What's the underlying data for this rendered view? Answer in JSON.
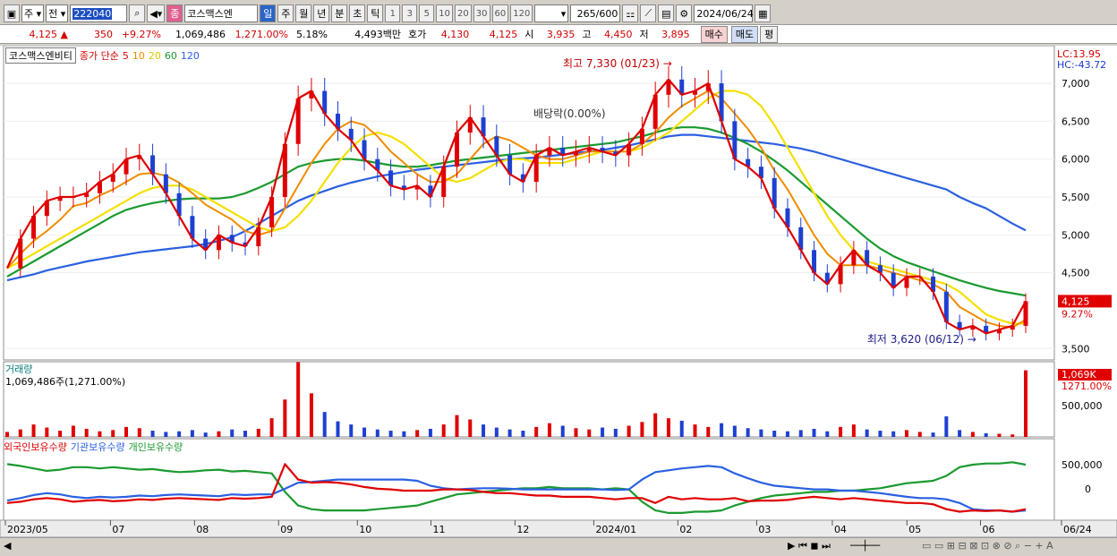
{
  "toolbar": {
    "period_type": "주",
    "prev_label": "전",
    "stock_code": "222040",
    "stock_name": "코스맥스엔",
    "tab_day": "일",
    "tab_week": "주",
    "tab_month": "월",
    "tab_year": "년",
    "tab_min": "분",
    "tab_sec": "초",
    "tab_tick": "틱",
    "intervals": [
      "1",
      "3",
      "5",
      "10",
      "20",
      "30",
      "60",
      "120"
    ],
    "count": "265",
    "count_total": "/600",
    "date": "2024/06/24",
    "badge": "종"
  },
  "quote": {
    "price": "4,125",
    "change": "350",
    "change_pct": "+9.27%",
    "volume": "1,069,486",
    "volume_ratio": "1,271.00%",
    "turnover": "5.18%",
    "amount": "4,493백만",
    "bid_label": "호가",
    "bid": "4,130",
    "ask": "4,125",
    "open_label": "시",
    "open": "3,935",
    "high_label": "고",
    "high": "4,450",
    "low_label": "저",
    "low": "3,895",
    "buy_button": "매수",
    "sell_button": "매도",
    "eval_button": "평"
  },
  "legend": {
    "stock": "코스맥스엔비티",
    "ma_label": "종가 단순",
    "ma_periods": [
      "5",
      "10",
      "20",
      "60",
      "120"
    ],
    "ma_colors": [
      "#e00000",
      "#f08c00",
      "#f0d800",
      "#1a9a30",
      "#2a60e0"
    ]
  },
  "price_panel": {
    "lc": "LC:13.95",
    "hc": "HC:-43.72",
    "price_tag": "4,125",
    "pct_tag": "9.27%",
    "high_note": "최고 7,330 (01/23)",
    "low_note": "최저 3,620 (06/12)",
    "dividend_note": "배당락(0.00%)"
  },
  "volume_panel": {
    "title": "거래량",
    "value": "1,069,486주(1,271.00%)",
    "tag": "1,069K",
    "tag2": "1271.00%"
  },
  "holding_panel": {
    "titles": [
      "외국인보유수량",
      "기관보유수량",
      "개인보유수량"
    ],
    "colors": [
      "#e00000",
      "#2a60e0",
      "#1a9a30"
    ]
  },
  "chart_data": {
    "type": "line",
    "price_yticks": [
      7000,
      6500,
      6000,
      5500,
      5000,
      4500,
      3500
    ],
    "price_ylim": [
      3350,
      7450
    ],
    "volume_yticks": [
      500000
    ],
    "holding_yticks": [
      500000,
      0
    ],
    "x_labels": [
      "2023/05",
      "07",
      "08",
      "09",
      "10",
      "11",
      "12",
      "2024/01",
      "02",
      "03",
      "04",
      "05",
      "06",
      "06/24"
    ],
    "close": [
      4560,
      4950,
      5250,
      5450,
      5500,
      5500,
      5550,
      5700,
      5800,
      6000,
      6050,
      5800,
      5550,
      5250,
      4950,
      4800,
      5000,
      4900,
      4850,
      5100,
      5500,
      6200,
      6800,
      6900,
      6600,
      6400,
      6250,
      6000,
      5850,
      5650,
      5600,
      5650,
      5500,
      5900,
      6350,
      6550,
      6300,
      6050,
      5800,
      5700,
      6050,
      6150,
      6050,
      6100,
      6150,
      6100,
      6050,
      6200,
      6400,
      6850,
      7050,
      6850,
      6900,
      7000,
      6500,
      6000,
      5900,
      5750,
      5350,
      5100,
      4800,
      4500,
      4350,
      4600,
      4800,
      4600,
      4500,
      4300,
      4450,
      4450,
      4250,
      3850,
      3750,
      3800,
      3700,
      3750,
      3800,
      4125
    ],
    "ma5": [
      4560,
      4750,
      4920,
      5050,
      5200,
      5380,
      5420,
      5520,
      5600,
      5700,
      5800,
      5820,
      5780,
      5690,
      5550,
      5400,
      5300,
      5200,
      5050,
      5000,
      5050,
      5350,
      5650,
      5950,
      6200,
      6400,
      6500,
      6450,
      6300,
      6100,
      5950,
      5800,
      5700,
      5700,
      5800,
      6000,
      6200,
      6300,
      6250,
      6150,
      6050,
      6000,
      6000,
      6050,
      6100,
      6100,
      6100,
      6100,
      6200,
      6350,
      6550,
      6700,
      6800,
      6900,
      6800,
      6600,
      6400,
      6150,
      5850,
      5600,
      5300,
      5000,
      4750,
      4600,
      4600,
      4600,
      4550,
      4500,
      4450,
      4400,
      4350,
      4250,
      4050,
      3950,
      3850,
      3800,
      3780,
      3880
    ],
    "ma20": [
      4560,
      4650,
      4750,
      4850,
      4950,
      5050,
      5150,
      5250,
      5350,
      5450,
      5550,
      5620,
      5650,
      5650,
      5600,
      5500,
      5400,
      5300,
      5200,
      5100,
      5050,
      5100,
      5250,
      5450,
      5700,
      5950,
      6150,
      6300,
      6350,
      6300,
      6200,
      6050,
      5900,
      5750,
      5700,
      5750,
      5850,
      5950,
      6000,
      6000,
      5950,
      5950,
      5950,
      6000,
      6050,
      6100,
      6100,
      6100,
      6150,
      6250,
      6350,
      6500,
      6650,
      6800,
      6900,
      6900,
      6850,
      6700,
      6450,
      6150,
      5850,
      5550,
      5250,
      5000,
      4800,
      4650,
      4600,
      4550,
      4500,
      4450,
      4400,
      4350,
      4250,
      4100,
      3950,
      3880,
      3830,
      3830
    ],
    "ma60": [
      4450,
      4550,
      4650,
      4750,
      4850,
      4950,
      5050,
      5150,
      5250,
      5330,
      5380,
      5420,
      5450,
      5470,
      5480,
      5480,
      5480,
      5500,
      5550,
      5620,
      5700,
      5800,
      5900,
      5950,
      5980,
      6000,
      6000,
      5980,
      5950,
      5920,
      5900,
      5900,
      5920,
      5950,
      5980,
      6000,
      6020,
      6040,
      6060,
      6080,
      6100,
      6120,
      6140,
      6160,
      6180,
      6200,
      6220,
      6260,
      6300,
      6350,
      6400,
      6420,
      6420,
      6400,
      6350,
      6280,
      6200,
      6100,
      5980,
      5850,
      5700,
      5550,
      5400,
      5250,
      5100,
      4950,
      4820,
      4720,
      4640,
      4580,
      4520,
      4460,
      4400,
      4350,
      4300,
      4260,
      4230,
      4200
    ],
    "ma120": [
      4400,
      4440,
      4480,
      4530,
      4570,
      4610,
      4650,
      4680,
      4710,
      4740,
      4770,
      4790,
      4810,
      4830,
      4850,
      4880,
      4920,
      4970,
      5050,
      5150,
      5250,
      5350,
      5450,
      5520,
      5580,
      5640,
      5690,
      5730,
      5770,
      5800,
      5830,
      5860,
      5880,
      5900,
      5920,
      5940,
      5960,
      5980,
      6000,
      6010,
      6020,
      6040,
      6060,
      6080,
      6100,
      6120,
      6150,
      6180,
      6220,
      6260,
      6300,
      6320,
      6320,
      6300,
      6280,
      6260,
      6240,
      6220,
      6200,
      6170,
      6140,
      6100,
      6050,
      6000,
      5950,
      5900,
      5850,
      5800,
      5750,
      5700,
      5650,
      5600,
      5500,
      5420,
      5350,
      5250,
      5150,
      5060
    ],
    "volume": [
      80000,
      120000,
      200000,
      150000,
      100000,
      180000,
      130000,
      90000,
      110000,
      160000,
      140000,
      100000,
      80000,
      90000,
      110000,
      70000,
      90000,
      120000,
      100000,
      130000,
      300000,
      600000,
      1200000,
      700000,
      400000,
      250000,
      200000,
      150000,
      120000,
      100000,
      90000,
      110000,
      130000,
      200000,
      350000,
      280000,
      200000,
      150000,
      120000,
      100000,
      160000,
      220000,
      180000,
      140000,
      120000,
      150000,
      130000,
      180000,
      240000,
      380000,
      300000,
      260000,
      200000,
      160000,
      220000,
      180000,
      140000,
      120000,
      100000,
      90000,
      110000,
      130000,
      90000,
      160000,
      200000,
      120000,
      100000,
      90000,
      110000,
      80000,
      70000,
      330000,
      110000,
      80000,
      60000,
      50000,
      40000,
      1069486
    ],
    "foreign": [
      0.22,
      0.24,
      0.28,
      0.3,
      0.28,
      0.24,
      0.26,
      0.27,
      0.25,
      0.26,
      0.28,
      0.27,
      0.29,
      0.3,
      0.29,
      0.28,
      0.27,
      0.3,
      0.29,
      0.3,
      0.32,
      0.85,
      0.6,
      0.55,
      0.56,
      0.55,
      0.52,
      0.48,
      0.45,
      0.44,
      0.42,
      0.42,
      0.42,
      0.44,
      0.44,
      0.43,
      0.4,
      0.38,
      0.38,
      0.36,
      0.34,
      0.34,
      0.32,
      0.32,
      0.32,
      0.3,
      0.28,
      0.3,
      0.3,
      0.22,
      0.32,
      0.28,
      0.3,
      0.28,
      0.28,
      0.3,
      0.25,
      0.26,
      0.26,
      0.27,
      0.3,
      0.32,
      0.3,
      0.28,
      0.3,
      0.28,
      0.26,
      0.24,
      0.22,
      0.22,
      0.2,
      0.12,
      0.08,
      0.1,
      0.09,
      0.1,
      0.08,
      0.12
    ],
    "institution": [
      0.26,
      0.3,
      0.35,
      0.38,
      0.36,
      0.32,
      0.3,
      0.32,
      0.31,
      0.32,
      0.34,
      0.33,
      0.35,
      0.36,
      0.35,
      0.34,
      0.33,
      0.36,
      0.35,
      0.36,
      0.36,
      0.45,
      0.55,
      0.56,
      0.58,
      0.6,
      0.6,
      0.6,
      0.6,
      0.6,
      0.6,
      0.58,
      0.5,
      0.46,
      0.44,
      0.45,
      0.46,
      0.46,
      0.45,
      0.44,
      0.44,
      0.44,
      0.44,
      0.44,
      0.44,
      0.44,
      0.43,
      0.44,
      0.6,
      0.72,
      0.75,
      0.78,
      0.8,
      0.82,
      0.8,
      0.7,
      0.62,
      0.55,
      0.5,
      0.48,
      0.46,
      0.44,
      0.44,
      0.42,
      0.42,
      0.4,
      0.38,
      0.35,
      0.32,
      0.3,
      0.3,
      0.28,
      0.22,
      0.12,
      0.1,
      0.1,
      0.08,
      0.1
    ],
    "individual": [
      0.85,
      0.82,
      0.78,
      0.74,
      0.76,
      0.8,
      0.8,
      0.78,
      0.8,
      0.78,
      0.76,
      0.77,
      0.74,
      0.72,
      0.73,
      0.75,
      0.76,
      0.73,
      0.74,
      0.72,
      0.7,
      0.4,
      0.18,
      0.12,
      0.1,
      0.1,
      0.1,
      0.1,
      0.12,
      0.14,
      0.16,
      0.18,
      0.24,
      0.3,
      0.36,
      0.38,
      0.4,
      0.42,
      0.44,
      0.46,
      0.46,
      0.48,
      0.46,
      0.46,
      0.46,
      0.44,
      0.46,
      0.44,
      0.24,
      0.1,
      0.06,
      0.06,
      0.08,
      0.08,
      0.1,
      0.18,
      0.24,
      0.3,
      0.34,
      0.36,
      0.38,
      0.4,
      0.4,
      0.42,
      0.42,
      0.44,
      0.46,
      0.5,
      0.54,
      0.56,
      0.58,
      0.66,
      0.8,
      0.84,
      0.86,
      0.86,
      0.88,
      0.84
    ]
  }
}
